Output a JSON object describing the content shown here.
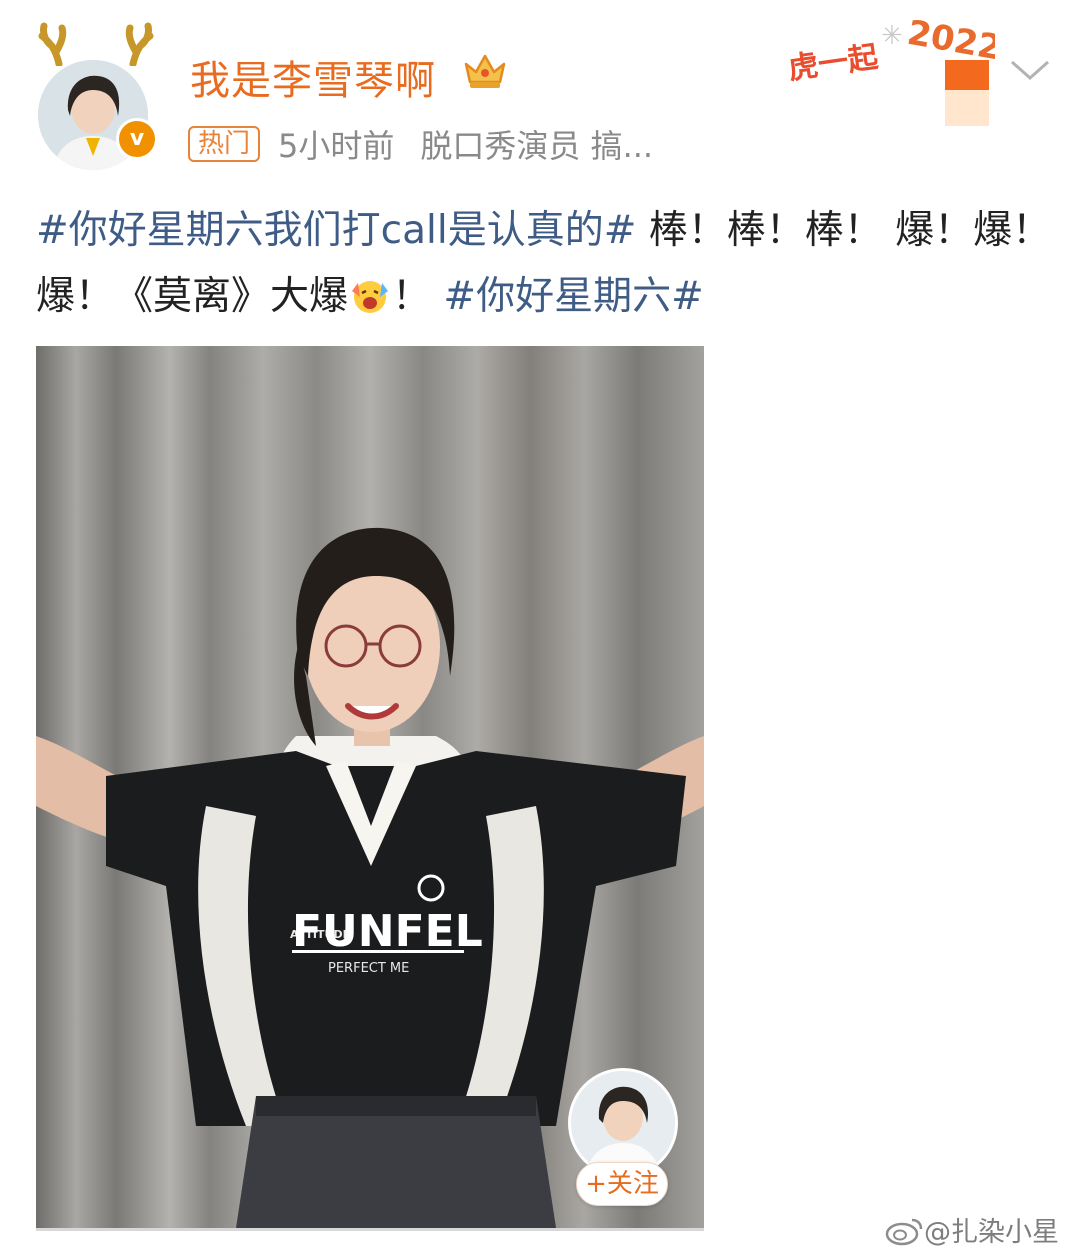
{
  "header": {
    "username": "我是李雪琴啊",
    "hot_badge": "热门",
    "time_ago": "5小时前",
    "bio": "脱口秀演员 搞...",
    "sticker_text": "虎一起 2022"
  },
  "post": {
    "hashtag1": "#你好星期六我们打call是认真的#",
    "text1": " 棒！棒！棒！ 爆！爆！爆！《莫离》大爆",
    "text2": "！ ",
    "hashtag2": "#你好星期六#"
  },
  "photo": {
    "shirt_brand": "FUNFEL",
    "shirt_sub": "PERFECT ME",
    "shirt_small": "ATTITUDE"
  },
  "follow": {
    "label": "+关注"
  },
  "watermark": {
    "text": "@扎染小星"
  },
  "colors": {
    "username": "#e86b1f",
    "hashtag": "#3f5c86",
    "badge": "#e8833a",
    "meta": "#8a8a8a"
  }
}
